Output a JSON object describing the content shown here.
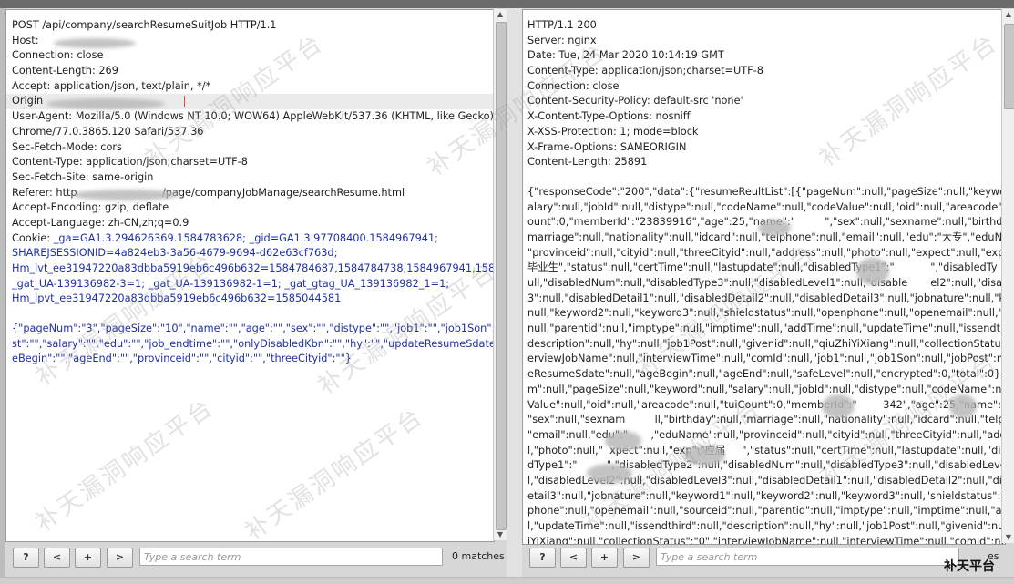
{
  "request": {
    "headers": [
      "POST /api/company/searchResumeSuitJob HTTP/1.1",
      "Host: ",
      "Connection: close",
      "Content-Length: 269",
      "Accept: application/json, text/plain, */*",
      "Origin",
      "User-Agent: Mozilla/5.0 (Windows NT 10.0; WOW64) AppleWebKit/537.36 (KHTML, like Gecko)",
      "Chrome/77.0.3865.120 Safari/537.36",
      "Sec-Fetch-Mode: cors",
      "Content-Type: application/json;charset=UTF-8",
      "Sec-Fetch-Site: same-origin",
      "Referer: http                          /page/companyJobManage/searchResume.html",
      "Accept-Encoding: gzip, deflate",
      "Accept-Language: zh-CN,zh;q=0.9"
    ],
    "cookie": {
      "label": "Cookie: ",
      "line1": "_ga=GA1.3.294626369.1584783628; _gid=GA1.3.97708400.1584967941;",
      "line2": "SHAREJSESSIONID=4a824eb3-3a56-4679-9694-d62e63cf763d;",
      "line3": "Hm_lvt_ee31947220a83dbba5919eb6c496b632=1584784687,1584784738,1584967941,1585036477;",
      "line4": "_gat_UA-139136982-3=1; _gat_UA-139136982-1=1; _gat_gtag_UA_139136982_1=1;",
      "line5": "Hm_lpvt_ee31947220a83dbba5919eb6c496b632=1585044581"
    },
    "body": [
      "{\"pageNum\":\"3\",\"pageSize\":\"10\",\"name\":\"\",\"age\":\"\",\"sex\":\"\",\"distype\":\"\",\"job1\":\"\",\"job1Son\":\"\",\"jobPo",
      "st\":\"\",\"salary\":\"\",\"edu\":\"\",\"job_endtime\":\"\",\"onlyDisabledKbn\":\"\",\"hy\":\"\",\"updateResumeSdate\":\"\",\"ag",
      "eBegin\":\"\",\"ageEnd\":\"\",\"provinceid\":\"\",\"cityid\":\"\",\"threeCityid\":\"\"}"
    ]
  },
  "response": {
    "headers": [
      "HTTP/1.1 200",
      "Server: nginx",
      "Date: Tue, 24 Mar 2020 10:14:19 GMT",
      "Content-Type: application/json;charset=UTF-8",
      "Connection: close",
      "Content-Security-Policy: default-src 'none'",
      "X-Content-Type-Options: nosniff",
      "X-XSS-Protection: 1; mode=block",
      "X-Frame-Options: SAMEORIGIN",
      "Content-Length: 25891"
    ],
    "body": [
      "{\"responseCode\":\"200\",\"data\":{\"resumeReultList\":[{\"pageNum\":null,\"pageSize\":null,\"keyword\":null,\"s",
      "alary\":null,\"jobId\":null,\"distype\":null,\"codeName\":null,\"codeValue\":null,\"oid\":null,\"areacode\":null,\"tuiC",
      "ount\":0,\"memberId\":\"23839916\",\"age\":25,\"name\":\"         \",\"sex\":null,\"sexname\":null,\"birthday\":null,\"",
      "marriage\":null,\"nationality\":null,\"idcard\":null,\"telphone\":null,\"email\":null,\"edu\":\"大专\",\"eduName\":null,",
      "\"provinceid\":null,\"cityid\":null,\"threeCityid\":null,\"address\":null,\"photo\":null,\"expect\":null,\"exp\":\"",
      "毕业生\",\"status\":null,\"certTime\":null,\"lastupdate\":null,\"disabledType1\":\"           \",\"disabledTy      :n",
      "ull,\"disabledNum\":null,\"disabledType3\":null,\"disabledLevel1\":null,\"disable       el2\":null,\"disabledLevel",
      "3\":null,\"disabledDetail1\":null,\"disabledDetail2\":null,\"disabledDetail3\":null,\"jobnature\":null,\"keyword1\":",
      "null,\"keyword2\":null,\"keyword3\":null,\"shieldstatus\":null,\"openphone\":null,\"openemail\":null,\"sourceid\":",
      "null,\"parentid\":null,\"imptype\":null,\"imptime\":null,\"addTime\":null,\"updateTime\":null,\"issendthird\":null,\"",
      "description\":null,\"hy\":null,\"job1Post\":null,\"givenid\":null,\"qiuZhiYiXiang\":null,\"collectionStatus\":\"0\",\"int",
      "erviewJobName\":null,\"interviewTime\":null,\"comId\":null,\"job1\":null,\"job1Son\":null,\"jobPost\":null,\"updat",
      "eResumeSdate\":null,\"ageBegin\":null,\"ageEnd\":null,\"safeLevel\":null,\"encrypted\":0,\"total\":0},{\"pageNu",
      "m\":null,\"pageSize\":null,\"keyword\":null,\"salary\":null,\"jobId\":null,\"distype\":null,\"codeName\":null,\"   de",
      "Value\":null,\"oid\":null,\"areacode\":null,\"tuiCount\":0,\"memberId\":\"        342\",\"age\":25,\"name\":\"    \",",
      "\"sex\":null,\"sexnam         ll,\"birthday\":null,\"marriage\":null,\"nationality\":null,\"idcard\":null,\"telphone\":null,",
      "\"email\":null,\"edu\":\"       ,\"eduName\":null,\"provinceid\":null,\"cityid\":null,\"threeCityid\":null,\"address\":nul",
      "l,\"photo\":null,\"  xpect\":null,\"exp\":\"应届     \",\"status\":null,\"certTime\":null,\"lastupdate\":null,\"disable",
      "dType1\":\"         \",\"disabledType2\":null,\"disabledNum\":null,\"disabledType3\":null,\"disabledLevel1\":nul",
      "l,\"disabledLevel2\":null,\"disabledLevel3\":null,\"disabledDetail1\":null,\"disabledDetail2\":null,\"disabledD",
      "etail3\":null,\"jobnature\":null,\"keyword1\":null,\"keyword2\":null,\"keyword3\":null,\"shieldstatus\":null,\"open",
      "phone\":null,\"openemail\":null,\"sourceid\":null,\"parentid\":null,\"imptype\":null,\"imptime\":null,\"addTime\":nul",
      "l,\"updateTime\":null,\"issendthird\":null,\"description\":null,\"hy\":null,\"job1Post\":null,\"givenid\":null,\"qiuZh",
      "iYiXiang\":null,\"collectionStatus\":\"0\",\"interviewJobName\":null,\"interviewTime\":null,\"comId\":null,\"job1\":"
    ]
  },
  "toolbar_left": {
    "help": "?",
    "prev": "<",
    "add": "+",
    "next": ">",
    "search_placeholder": "Type a search term",
    "matches": "0 matches"
  },
  "toolbar_right": {
    "help": "?",
    "prev": "<",
    "add": "+",
    "next": ">",
    "search_placeholder": "Type a search term",
    "matches": "es"
  },
  "watermark": "补天漏洞响应平台",
  "brand": "补天平台",
  "colors": {
    "cookie_value": "#1f2fa7",
    "highlight": "#c0392b",
    "body_text": "#1f2fa7",
    "pane_bg": "#ffffff"
  }
}
